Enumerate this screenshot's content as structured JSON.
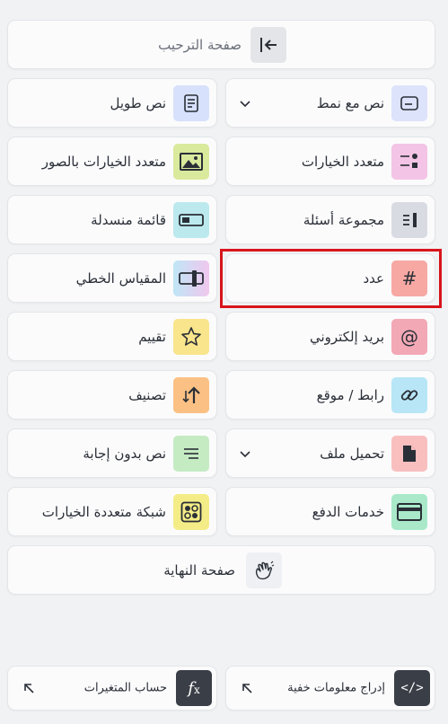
{
  "welcome": {
    "label": "صفحة الترحيب",
    "icon": "collapse-left-icon"
  },
  "left": [
    {
      "key": "long-text",
      "label": "نص طويل",
      "icon": "document-icon",
      "color": "#d7e1fb"
    },
    {
      "key": "image-multiple-choice",
      "label": "متعدد الخيارات بالصور",
      "icon": "image-icon",
      "color": "#d9ea9d"
    },
    {
      "key": "dropdown",
      "label": "قائمة منسدلة",
      "icon": "dropdown-icon",
      "color": "#bce9ee"
    },
    {
      "key": "linear-scale",
      "label": "المقياس الخطي",
      "icon": "slider-icon",
      "color": "#e6d3f6"
    },
    {
      "key": "rating",
      "label": "تقييم",
      "icon": "star-icon",
      "color": "#f9e58b"
    },
    {
      "key": "ranking",
      "label": "تصنيف",
      "icon": "sort-icon",
      "color": "#fbc184"
    },
    {
      "key": "no-answer-text",
      "label": "نص بدون إجابة",
      "icon": "lines-icon",
      "color": "#c5ebc3"
    },
    {
      "key": "multiple-choice-grid",
      "label": "شبكة متعددة الخيارات",
      "icon": "grid-icon",
      "color": "#f4ec87"
    }
  ],
  "right": [
    {
      "key": "text-with-type",
      "label": "نص مع نمط",
      "icon": "text-field-icon",
      "color": "#dde3fb",
      "dropdown": true
    },
    {
      "key": "multiple-choice",
      "label": "متعدد الخيارات",
      "icon": "choice-icon",
      "color": "#f3c4e5"
    },
    {
      "key": "question-group",
      "label": "مجموعة أسئلة",
      "icon": "group-icon",
      "color": "#d9dbe2"
    },
    {
      "key": "number",
      "label": "عدد",
      "icon": "hash-icon",
      "color": "#f7a8a3",
      "selected": true
    },
    {
      "key": "email",
      "label": "بريد إلكتروني",
      "icon": "at-icon",
      "color": "#f3a8b5"
    },
    {
      "key": "url",
      "label": "رابط / موقع",
      "icon": "link-icon",
      "color": "#b8e6f7"
    },
    {
      "key": "file-upload",
      "label": "تحميل ملف",
      "icon": "file-icon",
      "color": "#f9bfbf",
      "dropdown": true
    },
    {
      "key": "payment",
      "label": "خدمات الدفع",
      "icon": "card-icon",
      "color": "#a9e9c9"
    }
  ],
  "end": {
    "label": "صفحة النهاية",
    "icon": "wave-icon"
  },
  "bottom": {
    "variables": {
      "label": "حساب المتغيرات",
      "icon": "function-icon"
    },
    "hidden": {
      "label": "إدراج معلومات خفية",
      "icon": "code-icon"
    }
  },
  "accent": "#d8151b"
}
